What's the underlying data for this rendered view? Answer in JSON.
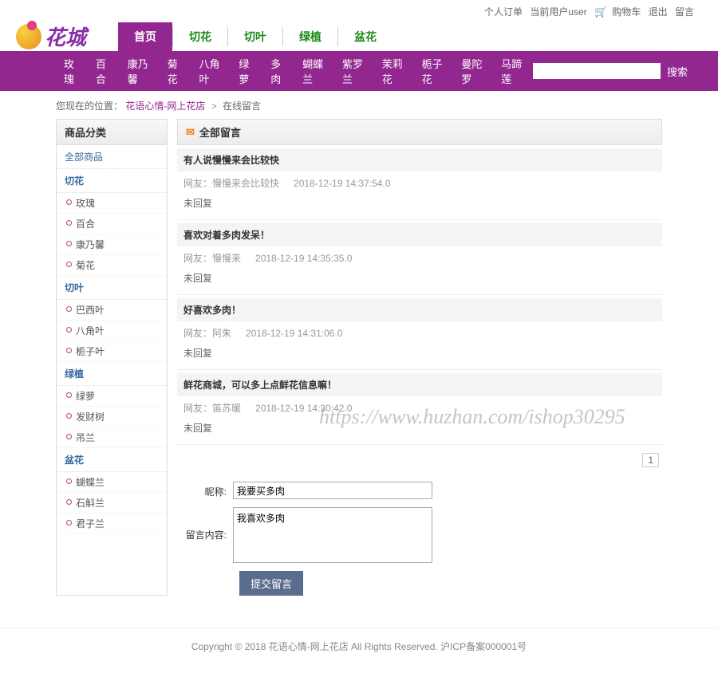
{
  "topbar": {
    "orders": "个人订单",
    "current_user_label": "当前用户user",
    "cart": "购物车",
    "logout": "退出",
    "messages": "留言"
  },
  "logo_text": "花城",
  "main_tabs": [
    "首页",
    "切花",
    "切叶",
    "绿植",
    "盆花"
  ],
  "menu_items": [
    "玫瑰",
    "百合",
    "康乃馨",
    "菊花",
    "八角叶",
    "绿萝",
    "多肉",
    "蝴蝶兰",
    "紫罗兰",
    "茉莉花",
    "栀子花",
    "曼陀罗",
    "马蹄莲"
  ],
  "search": {
    "placeholder": "",
    "button": "搜索"
  },
  "breadcrumb": {
    "prefix": "您现在的位置：",
    "home": "花语心情-网上花店",
    "current": "在线留言"
  },
  "sidebar": {
    "title": "商品分类",
    "all": "全部商品",
    "groups": [
      {
        "name": "切花",
        "children": [
          "玫瑰",
          "百合",
          "康乃馨",
          "菊花"
        ]
      },
      {
        "name": "切叶",
        "children": [
          "巴西叶",
          "八角叶",
          "栀子叶"
        ]
      },
      {
        "name": "绿植",
        "children": [
          "绿萝",
          "发财树",
          "吊兰"
        ]
      },
      {
        "name": "盆花",
        "children": [
          "蝴蝶兰",
          "石斛兰",
          "君子兰"
        ]
      }
    ]
  },
  "section": {
    "title": "全部留言",
    "reply_none": "未回复"
  },
  "messages": [
    {
      "title": "有人说慢慢来会比较快",
      "user_label": "网友：慢慢来会比较快",
      "time": "2018-12-19 14:37:54.0"
    },
    {
      "title": "喜欢对着多肉发呆！",
      "user_label": "网友：慢慢来",
      "time": "2018-12-19 14:35:35.0"
    },
    {
      "title": "好喜欢多肉！",
      "user_label": "网友：阿朱",
      "time": "2018-12-19 14:31:06.0"
    },
    {
      "title": "鲜花商城，可以多上点鲜花信息嘛！",
      "user_label": "网友：笛苏暖",
      "time": "2018-12-19 14:30:42.0"
    }
  ],
  "pager": {
    "current": "1"
  },
  "form": {
    "nickname_label": "昵称:",
    "nickname_value": "我要买多肉",
    "content_label": "留言内容:",
    "content_value": "我喜欢多肉",
    "submit": "提交留言"
  },
  "footer": "Copyright © 2018 花语心情-网上花店 All Rights Reserved. 沪ICP备案000001号",
  "watermark": "https://www.huzhan.com/ishop30295"
}
